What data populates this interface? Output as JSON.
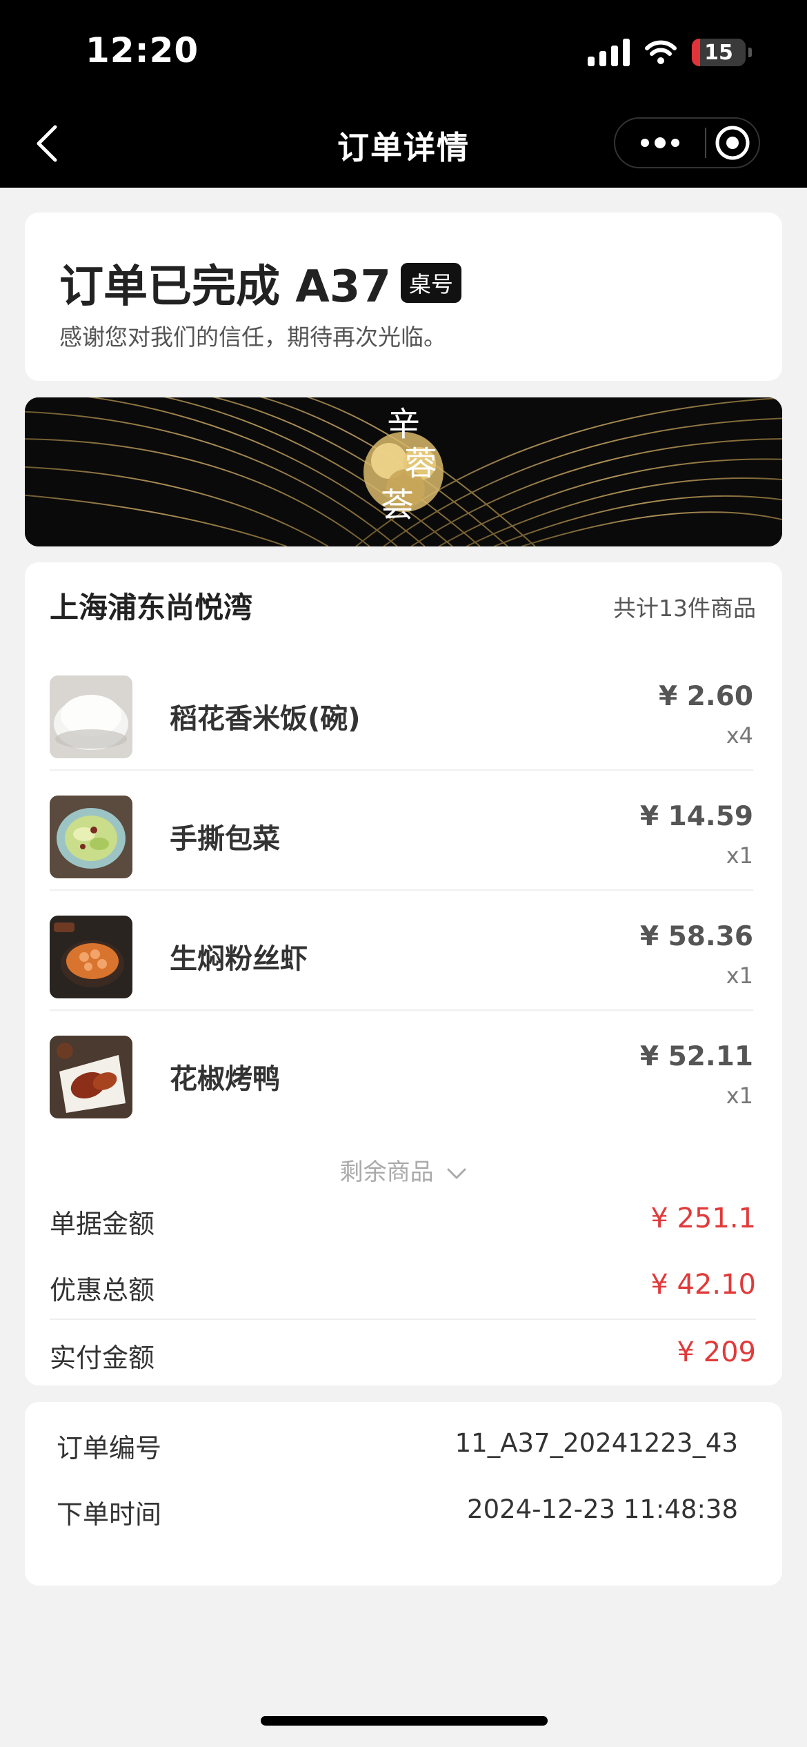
{
  "status_bar": {
    "time": "12:20",
    "battery": "15",
    "battery_level_percent": 15
  },
  "nav": {
    "title": "订单详情"
  },
  "order_status": {
    "title": "订单已完成 A37",
    "table_badge": "桌号",
    "subtitle": "感谢您对我们的信任，期待再次光临。"
  },
  "banner": {
    "brand_text": "辛蓉荟"
  },
  "store": {
    "name": "上海浦东尚悦湾",
    "item_count": "共计13件商品"
  },
  "items": [
    {
      "name": "稻花香米饭(碗)",
      "price": "¥ 2.60",
      "qty": "x4",
      "image": "rice-bowl-image"
    },
    {
      "name": "手撕包菜",
      "price": "¥ 14.59",
      "qty": "x1",
      "image": "cabbage-dish-image"
    },
    {
      "name": "生焖粉丝虾",
      "price": "¥ 58.36",
      "qty": "x1",
      "image": "shrimp-vermicelli-image"
    },
    {
      "name": "花椒烤鸭",
      "price": "¥ 52.11",
      "qty": "x1",
      "image": "roast-duck-image"
    }
  ],
  "more_items": "剩余商品",
  "summary": {
    "bill_label": "单据金额",
    "bill_value": "¥ 251.1",
    "discount_label": "优惠总额",
    "discount_value": "¥ 42.10",
    "paid_label": "实付金额",
    "paid_value": "¥ 209"
  },
  "order_info": {
    "number_label": "订单编号",
    "number_value": "11_A37_20241223_43",
    "time_label": "下单时间",
    "time_value": "2024-12-23 11:48:38"
  },
  "colors": {
    "accent_red": "#e03a3a",
    "header_bg": "#000000",
    "page_bg": "#f2f2f2"
  }
}
